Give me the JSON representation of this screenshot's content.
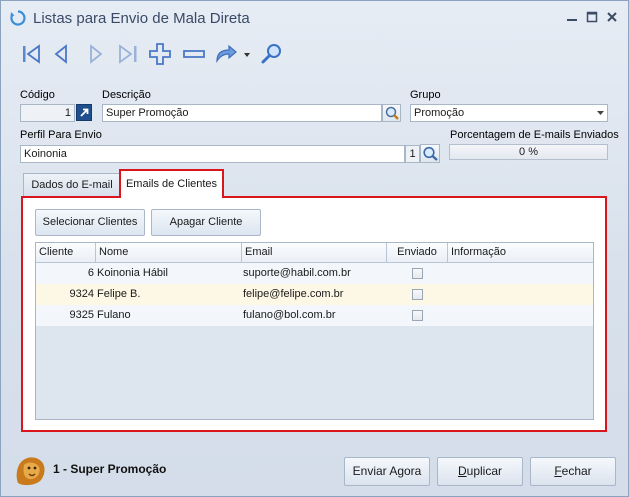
{
  "window": {
    "title": "Listas para Envio de Mala Direta",
    "controls": [
      "minimize-icon",
      "maximize-icon",
      "close-icon"
    ]
  },
  "toolbar": {
    "icons": [
      "first-record-icon",
      "previous-record-icon",
      "next-record-icon",
      "last-record-icon",
      "add-icon",
      "remove-icon",
      "redo-icon",
      "dropdown-arrow-icon",
      "search-icon"
    ]
  },
  "form": {
    "codigo_label": "Código",
    "codigo_value": "1",
    "descricao_label": "Descrição",
    "descricao_value": "Super Promoção",
    "grupo_label": "Grupo",
    "grupo_value": "Promoção",
    "perfil_label": "Perfil Para Envio",
    "perfil_value": "Koinonia",
    "perfil_code": "1",
    "porcentagem_label": "Porcentagem de E-mails Enviados",
    "porcentagem_value": "0 %",
    "porcentagem_fraction": 0
  },
  "tabs": [
    {
      "label": "Dados do E-mail",
      "active": false
    },
    {
      "label": "Emails de Clientes",
      "active": true
    }
  ],
  "panel": {
    "select_button": "Selecionar Clientes",
    "delete_button": "Apagar Cliente"
  },
  "grid": {
    "columns": [
      "Cliente",
      "Nome",
      "Email",
      "Enviado",
      "Informação"
    ],
    "rows": [
      {
        "cliente": "6",
        "nome": "Koinonia Hábil",
        "email": "suporte@habil.com.br",
        "enviado": false,
        "informacao": ""
      },
      {
        "cliente": "9324",
        "nome": "Felipe B.",
        "email": "felipe@felipe.com.br",
        "enviado": false,
        "informacao": ""
      },
      {
        "cliente": "9325",
        "nome": "Fulano",
        "email": "fulano@bol.com.br",
        "enviado": false,
        "informacao": ""
      }
    ]
  },
  "footer": {
    "status": "1 - Super Promoção",
    "enviar": "Enviar Agora",
    "duplicar_u": "D",
    "duplicar_rest": "uplicar",
    "fechar_u": "F",
    "fechar_rest": "echar"
  },
  "colors": {
    "accent_red": "#d9161b",
    "toolbar_blue": "#4a78c8",
    "row_alt": "#fdf8e6"
  }
}
